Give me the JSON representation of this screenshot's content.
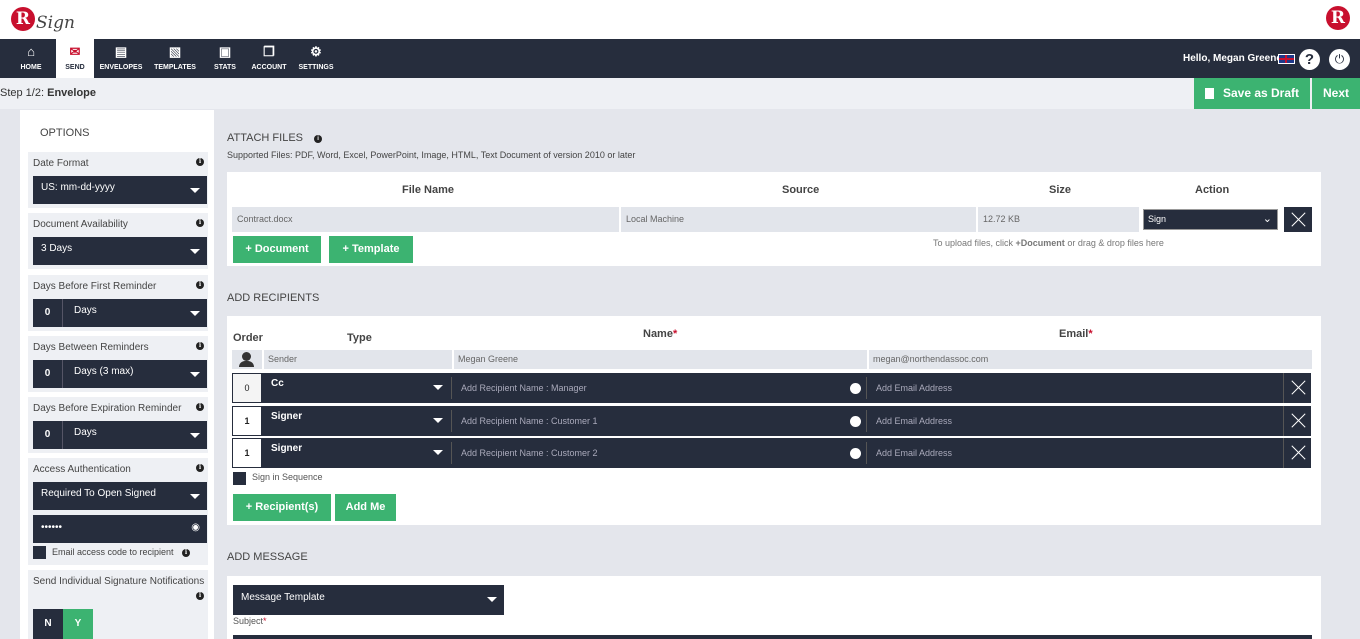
{
  "brand": {
    "logo_letter": "R",
    "logo_word": "Sign"
  },
  "nav": {
    "items": [
      {
        "label": "HOME",
        "icon": "home-icon"
      },
      {
        "label": "SEND",
        "icon": "envelope-icon"
      },
      {
        "label": "ENVELOPES",
        "icon": "inbox-icon"
      },
      {
        "label": "TEMPLATES",
        "icon": "template-icon"
      },
      {
        "label": "STATS",
        "icon": "briefcase-icon"
      },
      {
        "label": "ACCOUNT",
        "icon": "document-icon"
      },
      {
        "label": "SETTINGS",
        "icon": "gear-icon"
      }
    ],
    "active": "SEND",
    "greeting": "Hello, Megan Greene"
  },
  "step": {
    "prefix": "Step 1/2:",
    "title": "Envelope",
    "save_draft": "Save as Draft",
    "next": "Next"
  },
  "options": {
    "title": "OPTIONS",
    "date_format": {
      "label": "Date Format",
      "value": "US: mm-dd-yyyy"
    },
    "availability": {
      "label": "Document Availability",
      "value": "3 Days"
    },
    "first_reminder": {
      "label": "Days Before First Reminder",
      "number": "0",
      "unit": "Days"
    },
    "between_reminders": {
      "label": "Days Between Reminders",
      "number": "0",
      "unit": "Days (3 max)"
    },
    "expiration_reminder": {
      "label": "Days Before Expiration Reminder",
      "number": "0",
      "unit": "Days"
    },
    "access_auth": {
      "label": "Access Authentication",
      "value": "Required To Open Signed",
      "password_mask": "••••••",
      "email_code_label": "Email access code to recipient"
    },
    "individual_notifications": {
      "label": "Send Individual Signature Notifications",
      "no": "N",
      "yes": "Y"
    }
  },
  "attach": {
    "title": "ATTACH FILES",
    "supported": "Supported Files: PDF, Word, Excel, PowerPoint, Image, HTML, Text Document of version 2010 or later",
    "columns": {
      "file_name": "File Name",
      "source": "Source",
      "size": "Size",
      "action": "Action"
    },
    "files": [
      {
        "name": "Contract.docx",
        "source": "Local Machine",
        "size": "12.72 KB",
        "action": "Sign"
      }
    ],
    "add_document": "+ Document",
    "add_template": "+ Template",
    "hint_prefix": "To upload files, click ",
    "hint_bold": "+Document",
    "hint_suffix": " or drag & drop files here"
  },
  "recipients": {
    "title": "ADD RECIPIENTS",
    "columns": {
      "order": "Order",
      "type": "Type",
      "name": "Name",
      "email": "Email",
      "required": "*"
    },
    "sender": {
      "type": "Sender",
      "name": "Megan Greene",
      "email": "megan@northendassoc.com"
    },
    "rows": [
      {
        "order": "0",
        "type": "Cc",
        "name_placeholder": "Add Recipient Name : Manager",
        "email_placeholder": "Add Email Address"
      },
      {
        "order": "1",
        "type": "Signer",
        "name_placeholder": "Add Recipient Name : Customer 1",
        "email_placeholder": "Add Email Address"
      },
      {
        "order": "1",
        "type": "Signer",
        "name_placeholder": "Add Recipient Name : Customer 2",
        "email_placeholder": "Add Email Address"
      }
    ],
    "sign_in_sequence": "Sign in Sequence",
    "add_recipients": "+ Recipient(s)",
    "add_me": "Add Me"
  },
  "message": {
    "title": "ADD MESSAGE",
    "template_select": "Message Template",
    "subject_label": "Subject",
    "required": "*"
  },
  "colors": {
    "navy": "#262d3d",
    "green": "#3cb371",
    "brand_red": "#c8102e"
  }
}
